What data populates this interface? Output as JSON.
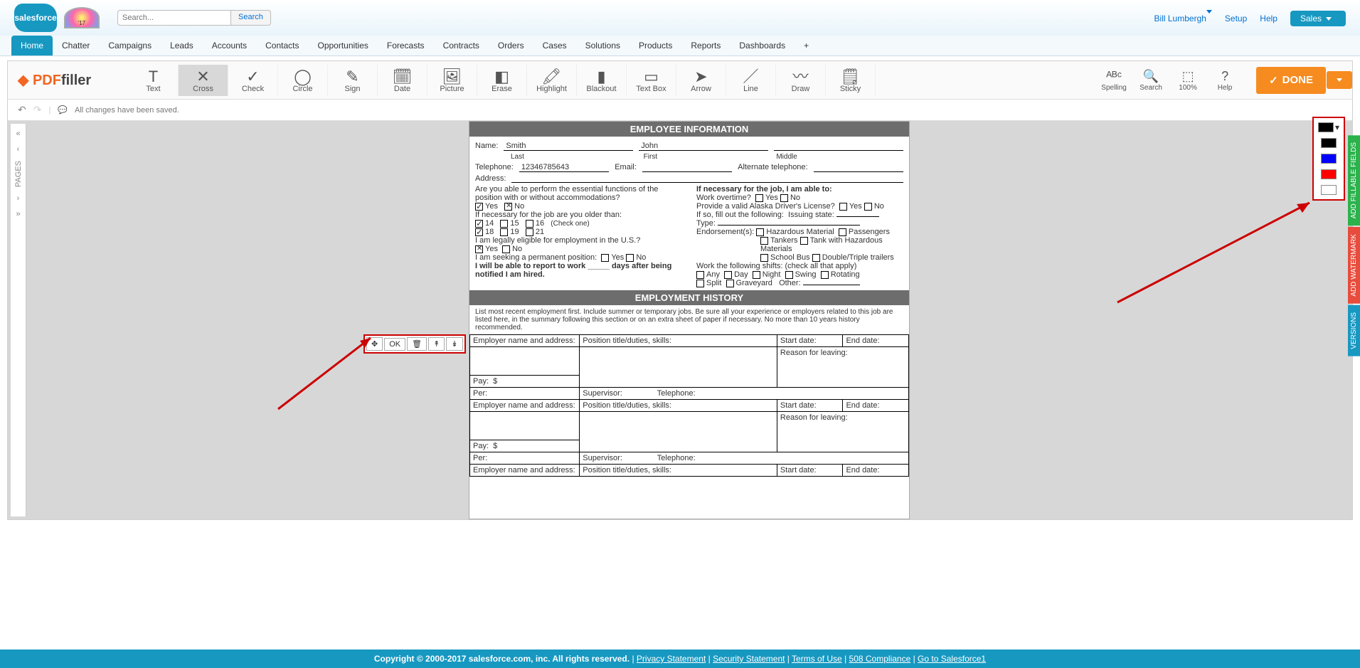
{
  "sf": {
    "logo": "salesforce",
    "rainbow": "'17",
    "searchPlaceholder": "Search...",
    "searchBtn": "Search",
    "user": "Bill Lumbergh",
    "setup": "Setup",
    "help": "Help",
    "appMenu": "Sales",
    "tabs": [
      "Home",
      "Chatter",
      "Campaigns",
      "Leads",
      "Accounts",
      "Contacts",
      "Opportunities",
      "Forecasts",
      "Contracts",
      "Orders",
      "Cases",
      "Solutions",
      "Products",
      "Reports",
      "Dashboards",
      "+"
    ],
    "activeTab": 0
  },
  "pf": {
    "brand1": "PDF",
    "brand2": "filler",
    "tools": [
      {
        "icon": "T",
        "label": "Text"
      },
      {
        "icon": "✕",
        "label": "Cross",
        "active": true
      },
      {
        "icon": "✓",
        "label": "Check"
      },
      {
        "icon": "◯",
        "label": "Circle"
      },
      {
        "icon": "✎",
        "label": "Sign"
      },
      {
        "icon": "🗓",
        "label": "Date"
      },
      {
        "icon": "🖼",
        "label": "Picture"
      },
      {
        "icon": "◧",
        "label": "Erase"
      },
      {
        "icon": "🖍",
        "label": "Highlight"
      },
      {
        "icon": "▮",
        "label": "Blackout"
      },
      {
        "icon": "▭",
        "label": "Text Box"
      },
      {
        "icon": "➤",
        "label": "Arrow"
      },
      {
        "icon": "／",
        "label": "Line"
      },
      {
        "icon": "〰",
        "label": "Draw"
      },
      {
        "icon": "🗒",
        "label": "Sticky"
      }
    ],
    "rtools": [
      {
        "icon": "ᴬᴮᶜ",
        "label": "Spelling"
      },
      {
        "icon": "🔍",
        "label": "Search"
      },
      {
        "icon": "⬚",
        "label": "100%"
      },
      {
        "icon": "?",
        "label": "Help"
      }
    ],
    "done": "DONE",
    "status": "All changes have been saved."
  },
  "doc": {
    "h1": "EMPLOYEE INFORMATION",
    "h2": "EMPLOYMENT HISTORY",
    "name": "Name:",
    "last": "Smith",
    "lastLbl": "Last",
    "first": "John",
    "firstLbl": "First",
    "middleLbl": "Middle",
    "tel": "Telephone:",
    "telVal": "12346785643",
    "email": "Email:",
    "altTel": "Alternate telephone:",
    "addr": "Address:",
    "q1": "Are you able to perform the essential functions of the position with or without accommodations?",
    "yes": "Yes",
    "no": "No",
    "q2": "If necessary for the job are you older than:",
    "ages": [
      "14",
      "15",
      "16",
      "18",
      "19",
      "21"
    ],
    "check": "(Check one)",
    "q3": "I am legally eligible for employment in the U.S.?",
    "q4": "I am seeking a permanent position:",
    "q5": "I will be able to report to work _____ days after being notified I am hired.",
    "r1": "If necessary for the job, I am able to:",
    "r1a": "Work overtime?",
    "r1b": "Provide a valid Alaska Driver's License?",
    "r2": "If so, fill out the following:",
    "r2a": "Issuing state:",
    "r2b": "Type:",
    "r2c": "Endorsement(s):",
    "end": [
      "Hazardous Material",
      "Passengers",
      "Tankers",
      "Tank with Hazardous Materials",
      "School Bus",
      "Double/Triple trailers"
    ],
    "r3": "Work the following shifts: (check all that apply)",
    "shifts": [
      "Any",
      "Day",
      "Night",
      "Swing",
      "Rotating",
      "Split",
      "Graveyard"
    ],
    "other": "Other:",
    "histNote": "List most recent employment first. Include summer or temporary jobs. Be sure all your experience or employers related to this job are listed here, in the summary following this section or on an extra sheet of paper if necessary. No more than 10 years history recommended.",
    "empName": "Employer name and address:",
    "posTitle": "Position title/duties, skills:",
    "start": "Start date:",
    "end2": "End date:",
    "reason": "Reason for leaving:",
    "pay": "Pay:",
    "dollar": "$",
    "per": "Per:",
    "super": "Supervisor:",
    "tel2": "Telephone:"
  },
  "popup": {
    "ok": "OK"
  },
  "colors": [
    "#000",
    "#00f",
    "#f00",
    "#fff"
  ],
  "side": [
    "ADD FILLABLE FIELDS",
    "ADD WATERMARK",
    "VERSIONS"
  ],
  "pages": "PAGES",
  "footer": {
    "copy": "Copyright © 2000-2017 salesforce.com, inc. All rights reserved.",
    "links": [
      "Privacy Statement",
      "Security Statement",
      "Terms of Use",
      "508 Compliance",
      "Go to Salesforce1"
    ]
  }
}
